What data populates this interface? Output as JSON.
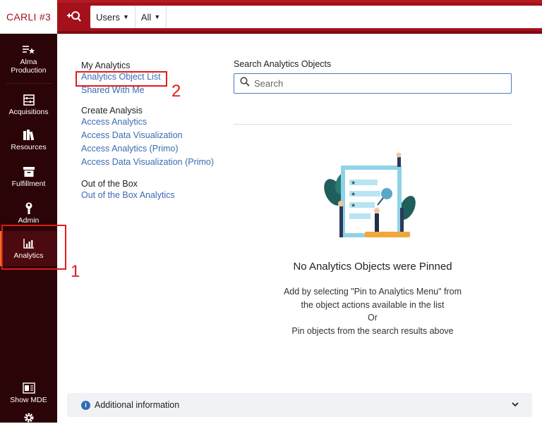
{
  "brand": {
    "name": "CARLI #3"
  },
  "topbar": {
    "search_scope": "Users",
    "search_filter": "All",
    "icons": {
      "add": "add-search-icon"
    }
  },
  "nav": {
    "items": [
      {
        "label": "Alma\nProduction",
        "icon": "alma-star-icon"
      },
      {
        "label": "Acquisitions",
        "icon": "abacus-icon"
      },
      {
        "label": "Resources",
        "icon": "books-icon"
      },
      {
        "label": "Fulfillment",
        "icon": "archive-icon"
      },
      {
        "label": "Admin",
        "icon": "wrench-icon"
      },
      {
        "label": "Analytics",
        "icon": "bar-chart-icon"
      },
      {
        "label": "Show MDE",
        "icon": "mde-icon"
      }
    ]
  },
  "annotations": {
    "callout_1": "1",
    "callout_2": "2",
    "color": "#e01b1b"
  },
  "menu": {
    "my_analytics": {
      "heading": "My Analytics",
      "links": [
        "Analytics Object List",
        "Shared With Me"
      ]
    },
    "create_analysis": {
      "heading": "Create Analysis",
      "links": [
        "Access Analytics",
        "Access Data Visualization",
        "Access Analytics (Primo)",
        "Access Data Visualization (Primo)"
      ]
    },
    "out_of_box": {
      "heading": "Out of the Box",
      "links": [
        "Out of the Box Analytics"
      ]
    }
  },
  "search": {
    "title": "Search Analytics Objects",
    "placeholder": "Search"
  },
  "empty_state": {
    "title": "No Analytics Objects were Pinned",
    "line1": "Add by selecting \"Pin to Analytics Menu\" from",
    "line2": "the object actions available in the list",
    "line3": "Or",
    "line4": "Pin objects from the search results above"
  },
  "additional_info": {
    "label": "Additional information"
  },
  "colors": {
    "brand_red": "#a4111b",
    "nav_bg": "#2b0407",
    "link": "#3b6bb4",
    "accent": "#e07a1f"
  }
}
